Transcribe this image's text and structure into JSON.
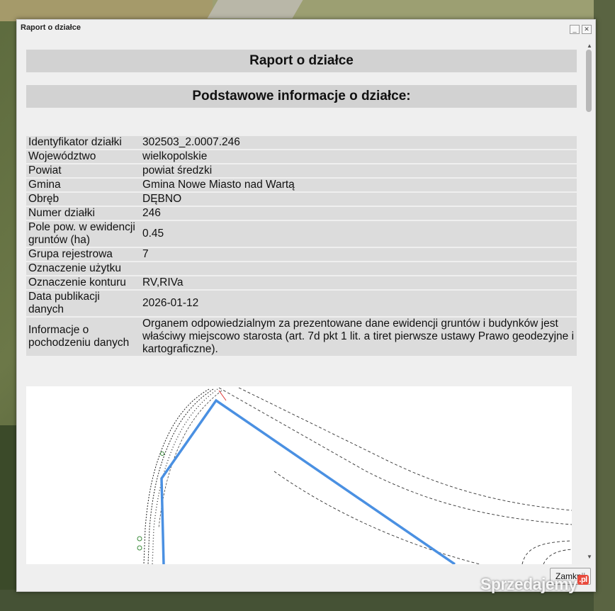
{
  "dialog": {
    "title": "Raport o działce",
    "minimize_label": "_",
    "close_icon_label": "✕",
    "heading": "Raport o działce",
    "subheading": "Podstawowe informacje o działce:",
    "rows": [
      {
        "key": "Identyfikator działki",
        "value": "302503_2.0007.246"
      },
      {
        "key": "Województwo",
        "value": "wielkopolskie"
      },
      {
        "key": "Powiat",
        "value": "powiat średzki"
      },
      {
        "key": "Gmina",
        "value": "Gmina Nowe Miasto nad Wartą"
      },
      {
        "key": "Obręb",
        "value": "DĘBNO"
      },
      {
        "key": "Numer działki",
        "value": "246"
      },
      {
        "key": "Pole pow. w ewidencji gruntów (ha)",
        "value": "0.45"
      },
      {
        "key": "Grupa rejestrowa",
        "value": "7"
      },
      {
        "key": "Oznaczenie użytku",
        "value": ""
      },
      {
        "key": "Oznaczenie konturu",
        "value": "RV,RIVa"
      },
      {
        "key": "Data publikacji danych",
        "value": "2026-01-12"
      },
      {
        "key": "Informacje o pochodzeniu danych",
        "value": "Organem odpowiedzialnym za prezentowane dane ewidencji gruntów i budynków jest właściwy miejscowo starosta (art. 7d pkt 1 lit. a tiret pierwsze ustawy Prawo geodezyjne i kartograficzne)."
      }
    ],
    "close_button": "Zamknij"
  },
  "watermark": {
    "text": "Sprzedajemy",
    "suffix": ".pl"
  },
  "colors": {
    "parcel_outline": "#4a90e2",
    "header_bg": "#d2d2d2",
    "row_bg": "#dcdcdc"
  }
}
